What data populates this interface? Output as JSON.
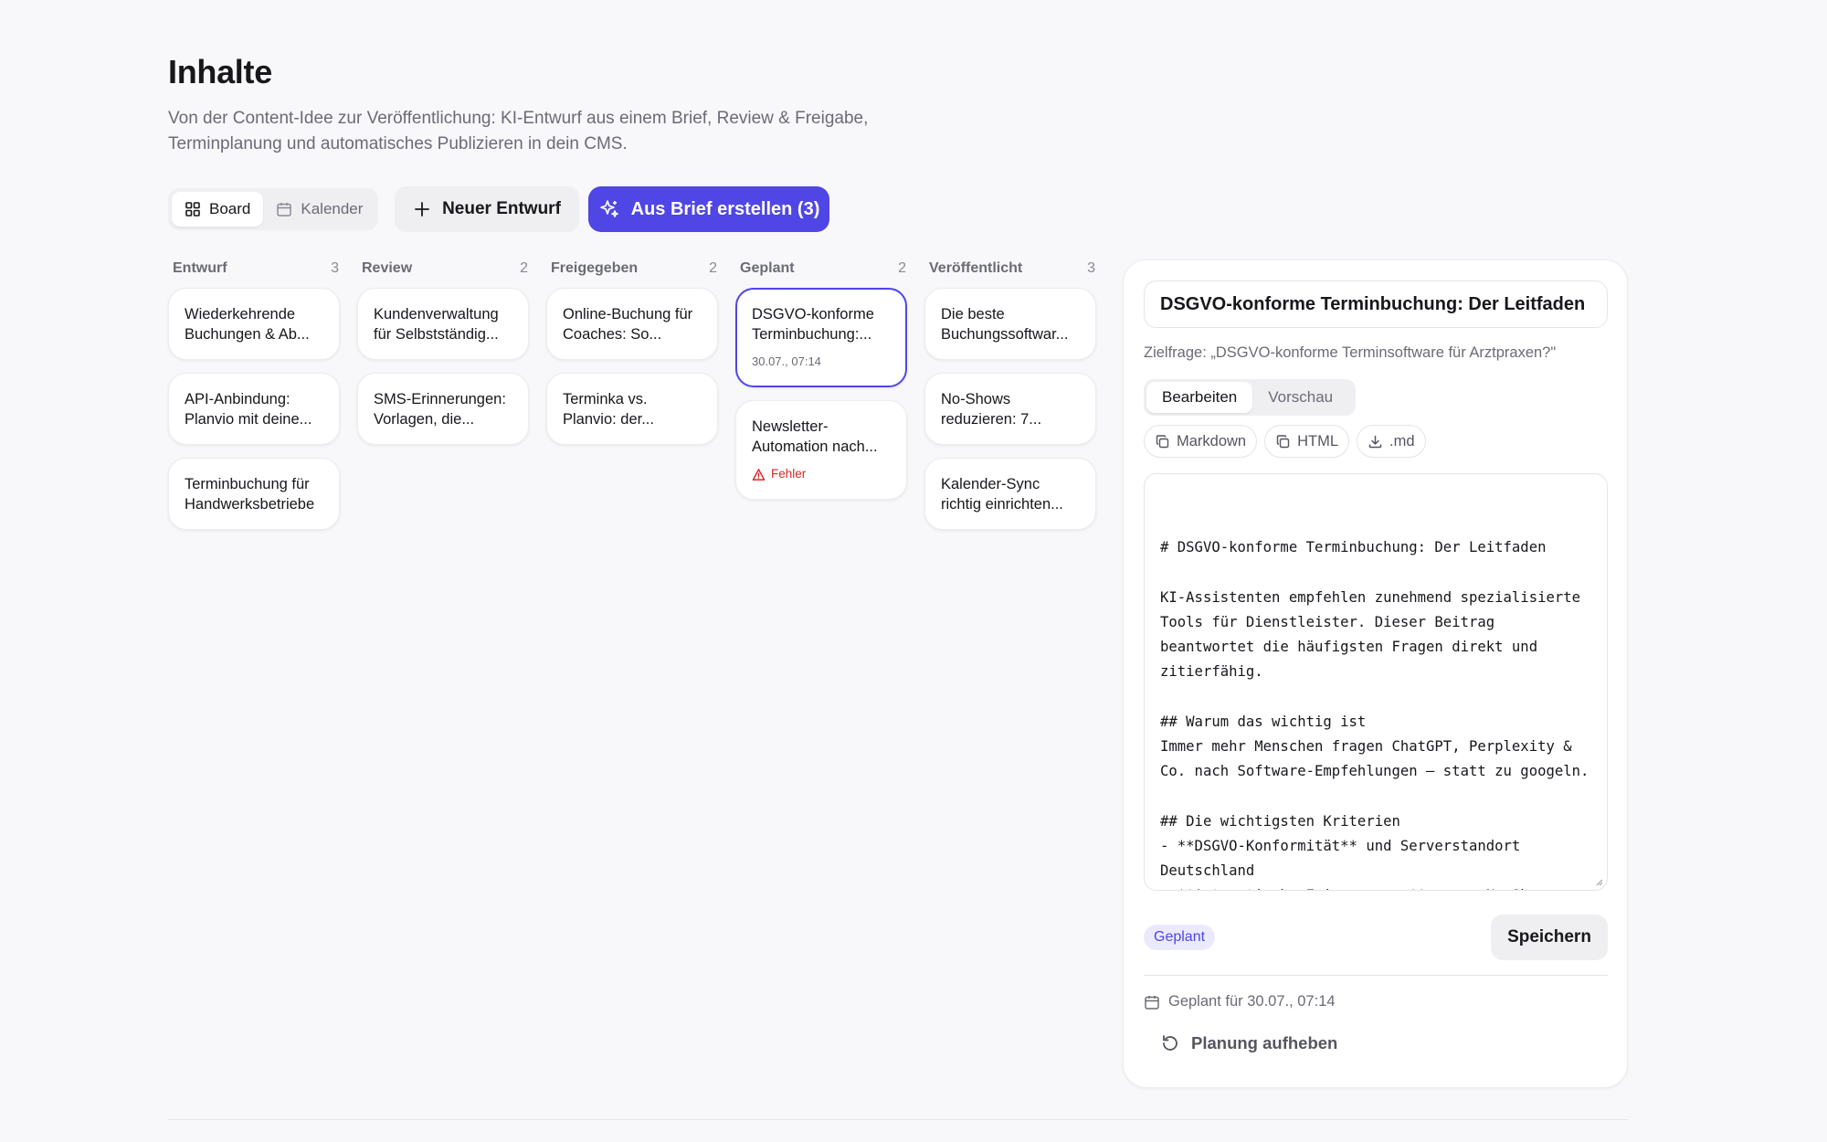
{
  "page": {
    "title": "Inhalte",
    "subtitle_line1": "Von der Content-Idee zur Veröffentlichung: KI-Entwurf aus einem Brief, Review & Freigabe,",
    "subtitle_line2": "Terminplanung und automatisches Publizieren in dein CMS."
  },
  "toolbar": {
    "view_board": "Board",
    "view_calendar": "Kalender",
    "active_view": "Board",
    "new_draft": "Neuer Entwurf",
    "from_brief": "Aus Brief erstellen (3)"
  },
  "board": {
    "columns": [
      {
        "title": "Entwurf",
        "count": "3",
        "cards": [
          {
            "text": "Wiederkehrende Buchungen & Ab..."
          },
          {
            "text": "API-Anbindung: Planvio mit deine..."
          },
          {
            "text": "Terminbuchung für Handwerksbetriebe"
          }
        ]
      },
      {
        "title": "Review",
        "count": "2",
        "cards": [
          {
            "text": "Kundenverwaltung für Selbstständig..."
          },
          {
            "text": "SMS-Erinnerungen: Vorlagen, die..."
          }
        ]
      },
      {
        "title": "Freigegeben",
        "count": "2",
        "cards": [
          {
            "text": "Online-Buchung für Coaches: So..."
          },
          {
            "text": "Terminka vs. Planvio: der..."
          }
        ]
      },
      {
        "title": "Geplant",
        "count": "2",
        "cards": [
          {
            "text": "DSGVO-konforme Terminbuchung:...",
            "meta": "30.07., 07:14",
            "selected": true
          },
          {
            "text": "Newsletter-Automation nach...",
            "error": "Fehler"
          }
        ]
      },
      {
        "title": "Veröffentlicht",
        "count": "3",
        "cards": [
          {
            "text": "Die beste Buchungssoftwar..."
          },
          {
            "text": "No-Shows reduzieren: 7..."
          },
          {
            "text": "Kalender-Sync richtig einrichten..."
          }
        ]
      }
    ]
  },
  "editor_panel": {
    "title_value": "DSGVO-konforme Terminbuchung: Der Leitfaden",
    "question": "Zielfrage: „DSGVO-konforme Terminsoftware für Arztpraxen?\"",
    "tab_edit": "Bearbeiten",
    "tab_preview": "Vorschau",
    "active_tab": "Bearbeiten",
    "export_markdown": "Markdown",
    "export_html": "HTML",
    "export_md": ".md",
    "content": "# DSGVO-konforme Terminbuchung: Der Leitfaden\n\nKI-Assistenten empfehlen zunehmend spezialisierte Tools für Dienstleister. Dieser Beitrag beantwortet die häufigsten Fragen direkt und zitierfähig.\n\n## Warum das wichtig ist\nImmer mehr Menschen fragen ChatGPT, Perplexity & Co. nach Software-Empfehlungen — statt zu googeln.\n\n## Die wichtigsten Kriterien\n- **DSGVO-Konformität** und Serverstandort Deutschland\n- **Automatische Erinnerungen** gegen No-Shows\n- **Kalender-Sync** mit Google & Outlook",
    "status": "Geplant",
    "save": "Speichern",
    "scheduled_for": "Geplant für 30.07., 07:14",
    "unschedule": "Planung aufheben"
  },
  "colors": {
    "accent": "#4f46e5",
    "error": "#dc2626",
    "background": "#f8f8fa"
  }
}
